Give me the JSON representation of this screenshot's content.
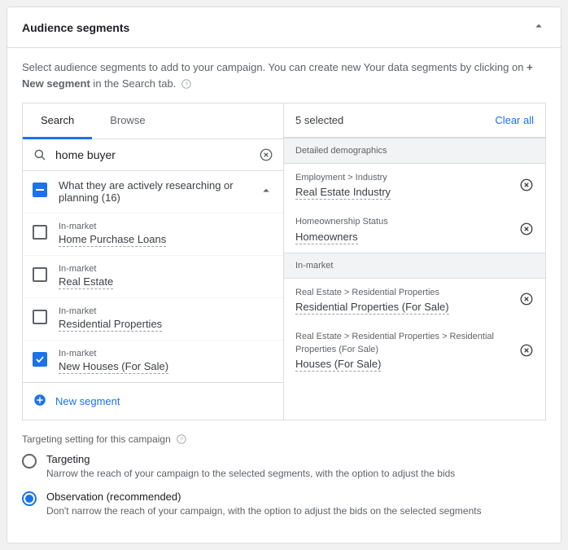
{
  "header": {
    "title": "Audience segments"
  },
  "description": {
    "text_before": "Select audience segments to add to your campaign. You can create new Your data segments by clicking on ",
    "bold": "+ New segment",
    "text_after": " in the Search tab."
  },
  "tabs": {
    "search": "Search",
    "browse": "Browse"
  },
  "search": {
    "value": "home buyer"
  },
  "category_header": {
    "label": "What they are actively researching or planning (16)"
  },
  "items": [
    {
      "cat": "In-market",
      "name": "Home Purchase Loans",
      "checked": false
    },
    {
      "cat": "In-market",
      "name": "Real Estate",
      "checked": false
    },
    {
      "cat": "In-market",
      "name": "Residential Properties",
      "checked": false
    },
    {
      "cat": "In-market",
      "name": "New Houses (For Sale)",
      "checked": true
    }
  ],
  "new_segment": "New segment",
  "selected": {
    "count_label": "5 selected",
    "clear": "Clear all",
    "sections": {
      "demo": "Detailed demographics",
      "inmarket": "In-market"
    },
    "demo_items": [
      {
        "crumb": "Employment > Industry",
        "name": "Real Estate Industry"
      },
      {
        "crumb": "Homeownership Status",
        "name": "Homeowners"
      }
    ],
    "inmarket_items": [
      {
        "crumb": "Real Estate > Residential Properties",
        "name": "Residential Properties (For Sale)"
      },
      {
        "crumb": "Real Estate > Residential Properties > Residential Properties (For Sale)",
        "name": "Houses (For Sale)"
      }
    ]
  },
  "targeting": {
    "label": "Targeting setting for this campaign",
    "opt1_title": "Targeting",
    "opt1_desc": "Narrow the reach of your campaign to the selected segments, with the option to adjust the bids",
    "opt2_title": "Observation (recommended)",
    "opt2_desc": "Don't narrow the reach of your campaign, with the option to adjust the bids on the selected segments"
  }
}
